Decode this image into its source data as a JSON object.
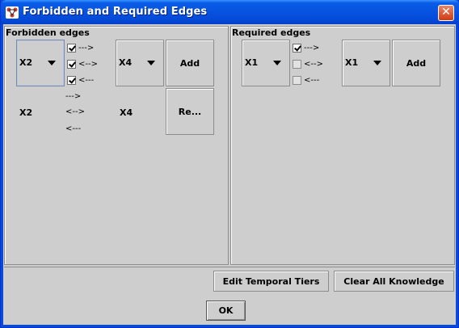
{
  "window": {
    "title": "Forbidden and Required Edges",
    "close_glyph": "✕",
    "titlebar_color": "#0653E0",
    "background_color": "#CECECE"
  },
  "forbidden": {
    "title": "Forbidden edges",
    "from_var": "X2",
    "to_var": "X4",
    "checks": [
      {
        "label": "--->",
        "checked": true
      },
      {
        "label": "<-->",
        "checked": true
      },
      {
        "label": "<---",
        "checked": true
      }
    ],
    "add_label": "Add",
    "remove_label": "Re...",
    "list": [
      {
        "from": "X2",
        "to": "X4",
        "arrows": [
          "--->",
          "<-->",
          "<---"
        ]
      }
    ]
  },
  "required": {
    "title": "Required edges",
    "from_var": "X1",
    "to_var": "X1",
    "checks": [
      {
        "label": "--->",
        "checked": true
      },
      {
        "label": "<-->",
        "checked": false
      },
      {
        "label": "<---",
        "checked": false
      }
    ],
    "add_label": "Add"
  },
  "buttons": {
    "edit_tiers": "Edit Temporal Tiers",
    "clear_all": "Clear All Knowledge",
    "ok": "OK"
  }
}
